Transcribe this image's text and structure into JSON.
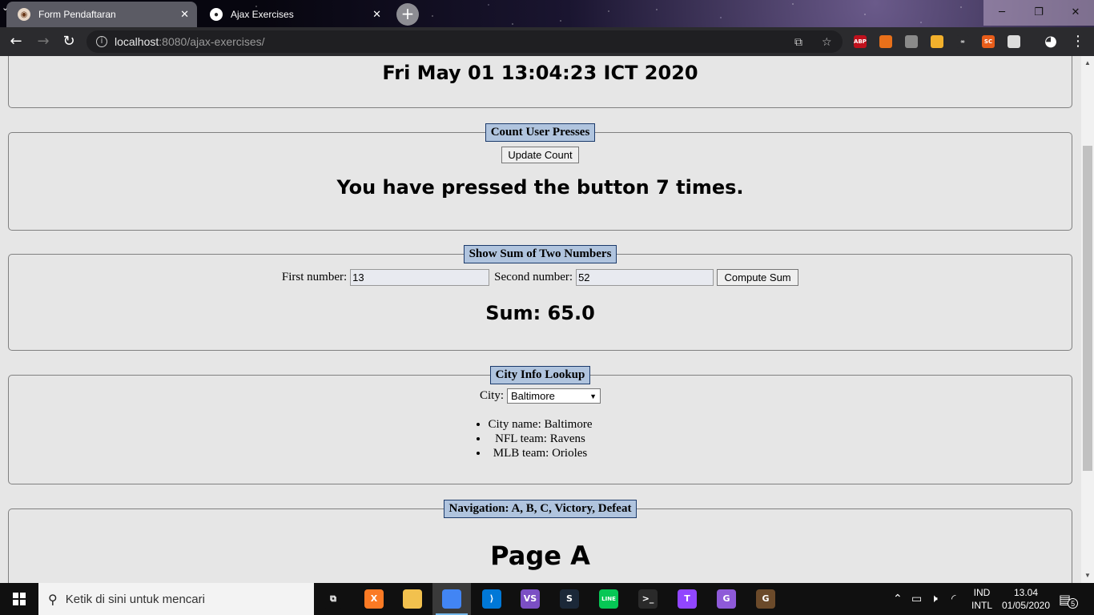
{
  "browser": {
    "tabs": [
      {
        "label": "Form Pendaftaran",
        "active": false
      },
      {
        "label": "Ajax Exercises",
        "active": true
      }
    ],
    "new_tab_symbol": "+",
    "url": {
      "host": "localhost",
      "port": ":8080",
      "path": "/ajax-exercises/"
    },
    "extensions": [
      {
        "name": "abp-icon",
        "text": "ABP",
        "color": "#c0111d"
      },
      {
        "name": "honey-icon",
        "text": "",
        "color": "#e8701a"
      },
      {
        "name": "ext-icon-gray",
        "text": "",
        "color": "#8a8a8a"
      },
      {
        "name": "ext-icon-folder",
        "text": "",
        "color": "#f2b02c"
      },
      {
        "name": "infinity-icon",
        "text": "∞",
        "color": "#2b2b2e"
      },
      {
        "name": "sc-icon",
        "text": "SC",
        "color": "#e85d1a"
      },
      {
        "name": "ext-icon-circle",
        "text": "",
        "color": "#dcdcdc"
      }
    ]
  },
  "page": {
    "date_panel": {
      "timestamp": "Fri May 01 13:04:23 ICT 2020"
    },
    "count_panel": {
      "legend": "Count User Presses",
      "button_label": "Update Count",
      "message": "You have pressed the button 7 times."
    },
    "sum_panel": {
      "legend": "Show Sum of Two Numbers",
      "first_label": "First number:",
      "first_value": "13",
      "second_label": "Second number:",
      "second_value": "52",
      "button_label": "Compute Sum",
      "result": "Sum: 65.0"
    },
    "city_panel": {
      "legend": "City Info Lookup",
      "city_label": "City:",
      "selected_city": "Baltimore",
      "info": [
        "City name: Baltimore",
        "NFL team: Ravens",
        "MLB team: Orioles"
      ]
    },
    "nav_panel": {
      "legend": "Navigation: A, B, C, Victory, Defeat",
      "page_title": "Page A"
    }
  },
  "taskbar": {
    "search_placeholder": "Ketik di sini untuk mencari",
    "apps": [
      {
        "name": "task-view-icon",
        "text": "⧉",
        "color": "#101010",
        "active": false
      },
      {
        "name": "xampp-icon",
        "text": "X",
        "color": "#fb7a24",
        "active": false
      },
      {
        "name": "file-explorer-icon",
        "text": "",
        "color": "#f2c14e",
        "active": false
      },
      {
        "name": "chrome-icon",
        "text": "",
        "color": "#4285f4",
        "active": true
      },
      {
        "name": "vscode-icon",
        "text": "⟩",
        "color": "#0078d7",
        "active": false
      },
      {
        "name": "visual-studio-icon",
        "text": "VS",
        "color": "#7b4fc4",
        "active": false
      },
      {
        "name": "steam-icon",
        "text": "S",
        "color": "#1b2838",
        "active": false
      },
      {
        "name": "line-icon",
        "text": "LINE",
        "color": "#06c755",
        "active": false
      },
      {
        "name": "terminal-icon",
        "text": ">_",
        "color": "#2a2a2a",
        "active": false
      },
      {
        "name": "twitch-icon",
        "text": "T",
        "color": "#9146ff",
        "active": false
      },
      {
        "name": "github-desktop-icon",
        "text": "G",
        "color": "#8e5ad8",
        "active": false
      },
      {
        "name": "game-icon",
        "text": "G",
        "color": "#6b4a2a",
        "active": false
      }
    ],
    "language": "IND",
    "keyboard": "INTL",
    "time": "13.04",
    "date": "01/05/2020",
    "notifications": "5"
  }
}
